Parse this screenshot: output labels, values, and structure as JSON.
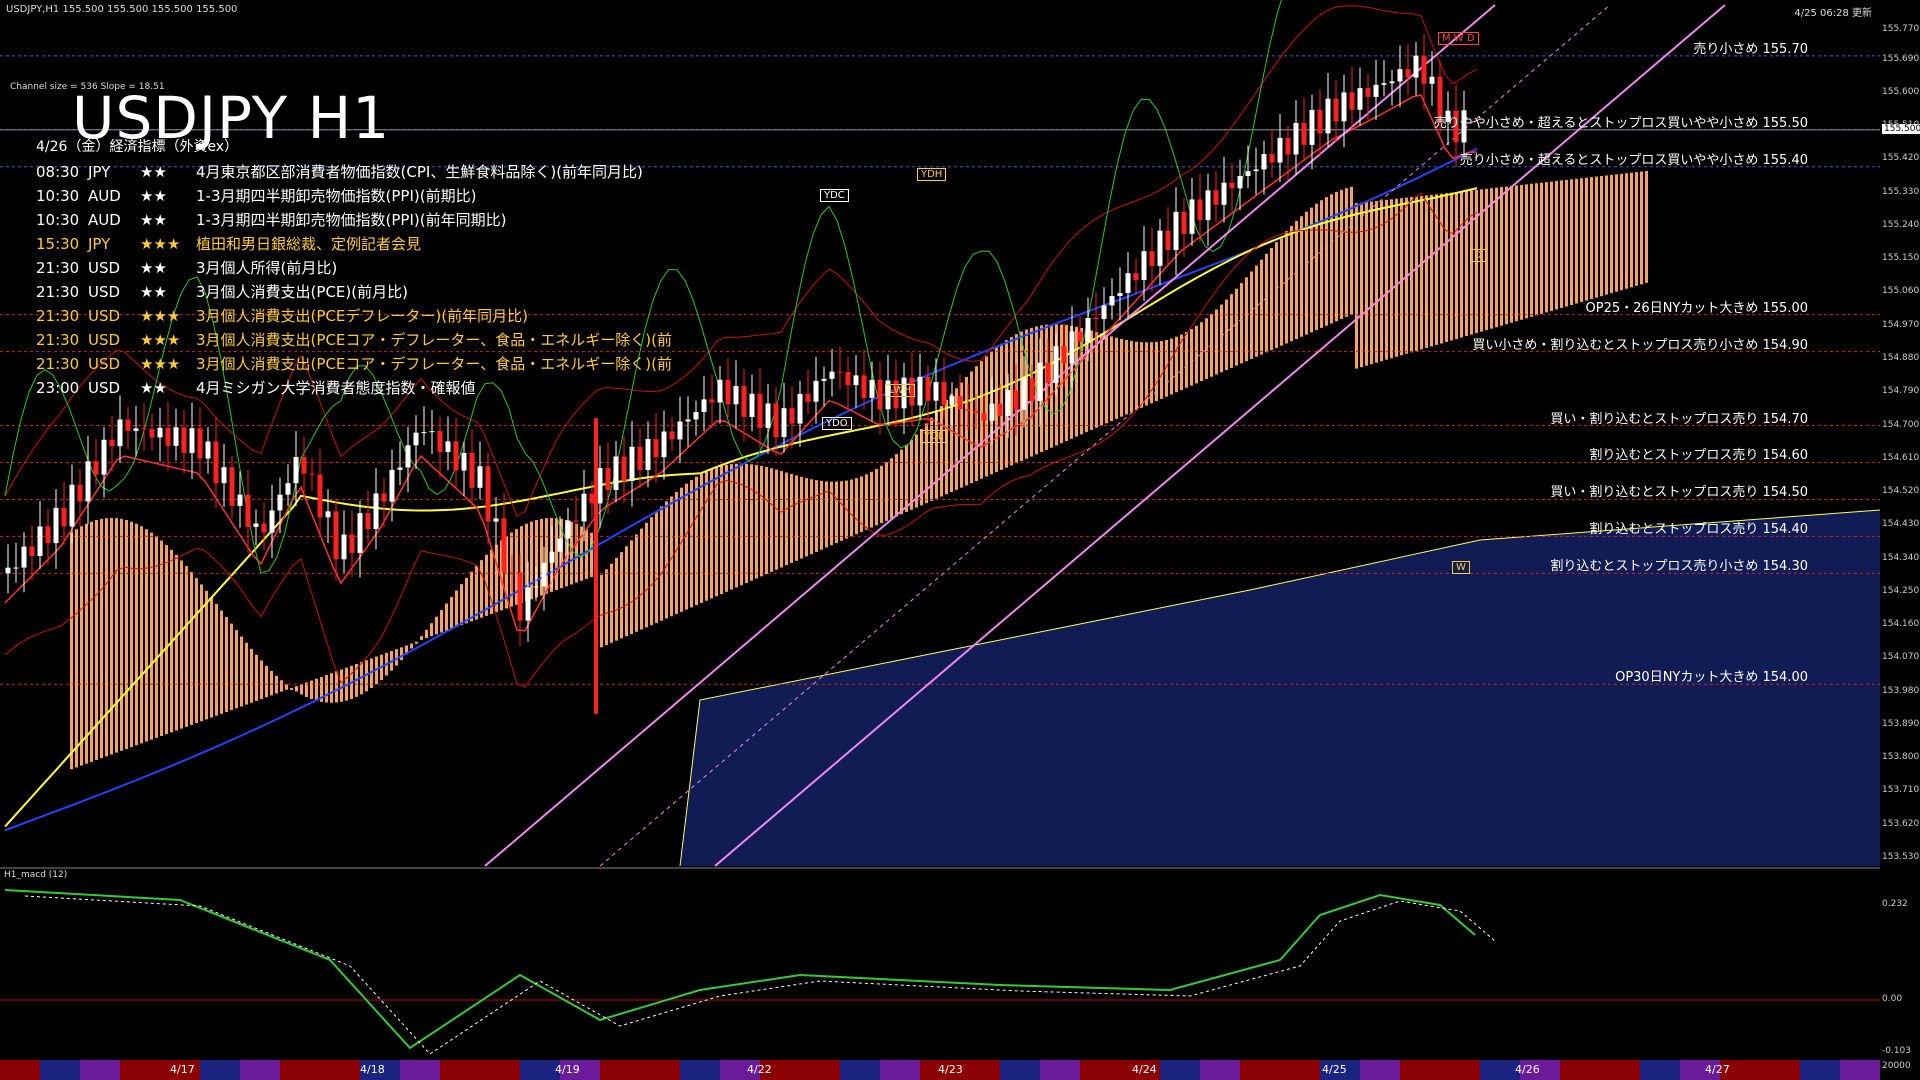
{
  "header": {
    "symbol_info": "USDJPY,H1  155.500 155.500 155.500 155.500",
    "updated": "4/25 06:28 更新",
    "channel_info": "Channel size = 536 Slope = 18.51",
    "title": "USDJPY H1",
    "macd_label": "H1_macd (12)"
  },
  "events": {
    "title": "4/26（金）経済指標（外資ex）",
    "rows": [
      {
        "time": "08:30",
        "currency": "JPY",
        "stars": "★★",
        "desc": "4月東京都区部消費者物価指数(CPI、生鮮食料品除く)(前年同月比)",
        "color": "#ffffff"
      },
      {
        "time": "10:30",
        "currency": "AUD",
        "stars": "★★",
        "desc": "1-3月期四半期卸売物価指数(PPI)(前期比)",
        "color": "#ffffff"
      },
      {
        "time": "10:30",
        "currency": "AUD",
        "stars": "★★",
        "desc": "1-3月期四半期卸売物価指数(PPI)(前年同期比)",
        "color": "#ffffff"
      },
      {
        "time": "15:30",
        "currency": "JPY",
        "stars": "★★★",
        "desc": "植田和男日銀総裁、定例記者会見",
        "color": "#ffcc33"
      },
      {
        "time": "21:30",
        "currency": "USD",
        "stars": "★★",
        "desc": "3月個人所得(前月比)",
        "color": "#ffffff"
      },
      {
        "time": "21:30",
        "currency": "USD",
        "stars": "★★",
        "desc": "3月個人消費支出(PCE)(前月比)",
        "color": "#ffffff"
      },
      {
        "time": "21:30",
        "currency": "USD",
        "stars": "★★★",
        "desc": "3月個人消費支出(PCEデフレーター)(前年同月比)",
        "color": "#ffcc33"
      },
      {
        "time": "21:30",
        "currency": "USD",
        "stars": "★★★",
        "desc": "3月個人消費支出(PCEコア・デフレーター、食品・エネルギー除く)(前",
        "color": "#ffcc33"
      },
      {
        "time": "21:30",
        "currency": "USD",
        "stars": "★★★",
        "desc": "3月個人消費支出(PCEコア・デフレーター、食品・エネルギー除く)(前",
        "color": "#ffcc33"
      },
      {
        "time": "23:00",
        "currency": "USD",
        "stars": "★★",
        "desc": "4月ミシガン大学消費者態度指数・確報値",
        "color": "#ffffff"
      }
    ]
  },
  "levels": [
    {
      "text": "売り小さめ 155.70",
      "price": 155.7
    },
    {
      "text": "売りやや小さめ・超えるとストップロス買いやや小さめ 155.50",
      "price": 155.5
    },
    {
      "text": "売り小さめ・超えるとストップロス買いやや小さめ 155.40",
      "price": 155.4
    },
    {
      "text": "OP25・26日NYカット大きめ 155.00",
      "price": 155.0
    },
    {
      "text": "買い小さめ・割り込むとストップロス売り小さめ 154.90",
      "price": 154.9
    },
    {
      "text": "買い・割り込むとストップロス売り 154.70",
      "price": 154.7
    },
    {
      "text": "割り込むとストップロス売り 154.60",
      "price": 154.6
    },
    {
      "text": "買い・割り込むとストップロス売り 154.50",
      "price": 154.5
    },
    {
      "text": "割り込むとストップロス売り 154.40",
      "price": 154.4
    },
    {
      "text": "割り込むとストップロス売り小さめ 154.30",
      "price": 154.3
    },
    {
      "text": "OP30日NYカット大きめ 154.00",
      "price": 154.0
    }
  ],
  "price_axis": [
    "155.770",
    "155.690",
    "155.600",
    "155.510",
    "155.420",
    "155.330",
    "155.240",
    "155.150",
    "155.060",
    "154.970",
    "154.880",
    "154.790",
    "154.700",
    "154.610",
    "154.520",
    "154.430",
    "154.340",
    "154.250",
    "154.160",
    "154.070",
    "153.980",
    "153.890",
    "153.800",
    "153.710",
    "153.620",
    "153.530"
  ],
  "current_price": "155.500",
  "macd_axis": {
    "top": "0.232",
    "zero": "0.00",
    "bottom": "-0.103",
    "vol": "20000"
  },
  "dates": [
    "4/17",
    "4/18",
    "4/19",
    "4/22",
    "4/23",
    "4/24",
    "4/25",
    "4/26",
    "4/27"
  ],
  "tags": {
    "ydh": "YDH",
    "ydc": "YDC",
    "ydo": "YDO",
    "ydl": "YDL",
    "lwh": "LWH",
    "w": "W",
    "d": "D",
    "mwd": "M W D"
  },
  "colors": {
    "bg": "#000000",
    "bull": "#ffffff",
    "bear": "#ff2020",
    "cloud": "#f4a460",
    "cloud2": "#1e2e8c",
    "yellow": "#ffff33",
    "blue": "#2244ff",
    "green": "#22cc22",
    "magenta": "#ee88ee"
  }
}
